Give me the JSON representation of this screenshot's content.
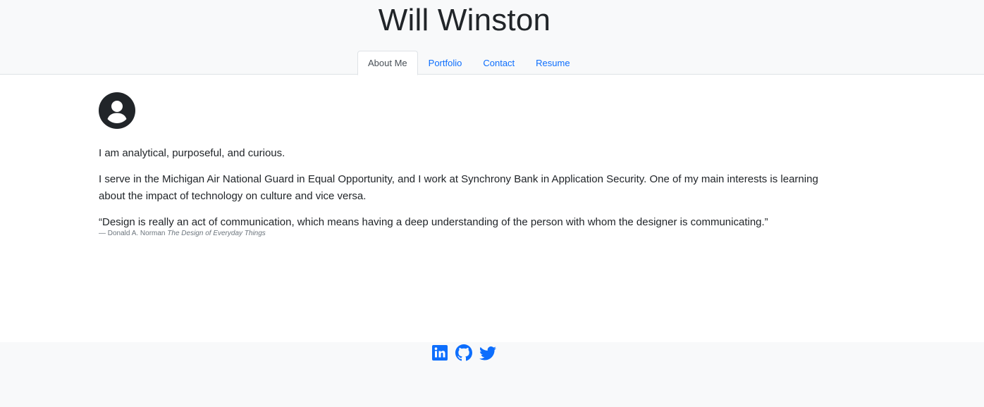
{
  "header": {
    "title": "Will Winston",
    "nav": [
      {
        "label": "About Me",
        "active": true
      },
      {
        "label": "Portfolio",
        "active": false
      },
      {
        "label": "Contact",
        "active": false
      },
      {
        "label": "Resume",
        "active": false
      }
    ]
  },
  "main": {
    "avatar_icon": "person-circle-icon",
    "intro": "I am analytical, purposeful, and curious.",
    "bio": "I serve in the Michigan Air National Guard in Equal Opportunity, and I work at Synchrony Bank in Application Security. One of my main interests is learning about the impact of technology on culture and vice versa.",
    "quote": "“Design is really an act of communication, which means having a deep understanding of the person with whom the designer is communicating.”",
    "citation_author": "— Donald A. Norman",
    "citation_title": "The Design of Everyday Things"
  },
  "footer": {
    "social_icons": [
      "linkedin-icon",
      "github-icon",
      "twitter-icon"
    ]
  },
  "colors": {
    "link": "#0d6efd",
    "header_bg": "#f8f9fa",
    "text": "#212529"
  }
}
